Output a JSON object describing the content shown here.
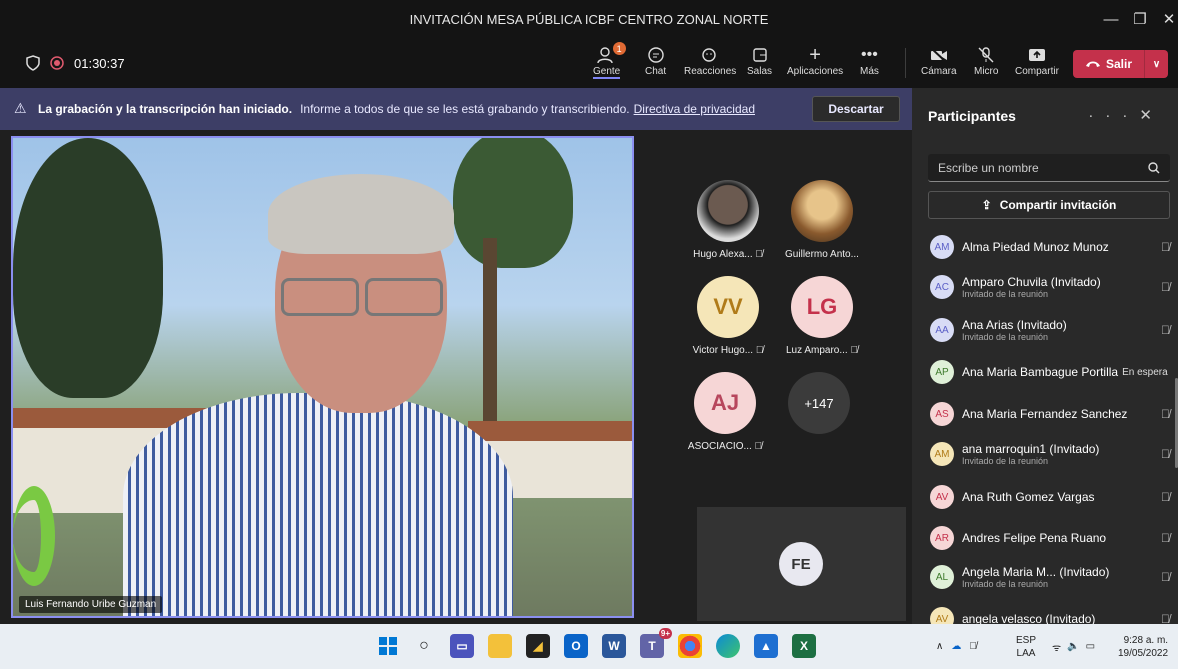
{
  "window": {
    "title": "INVITACIÓN MESA PÚBLICA ICBF CENTRO ZONAL NORTE",
    "controls": [
      "—",
      "❐",
      "✕"
    ]
  },
  "toolbar": {
    "timer": "01:30:37",
    "people_badge": "1",
    "items": [
      {
        "label": "Gente",
        "icon": "people-icon"
      },
      {
        "label": "Chat",
        "icon": "chat-icon"
      },
      {
        "label": "Reacciones",
        "icon": "reactions-icon"
      },
      {
        "label": "Salas",
        "icon": "rooms-icon"
      },
      {
        "label": "Aplicaciones",
        "icon": "plus-icon"
      },
      {
        "label": "Más",
        "icon": "more-icon"
      }
    ],
    "av_controls": [
      {
        "label": "Cámara",
        "icon": "camera-off-icon"
      },
      {
        "label": "Micro",
        "icon": "mic-off-icon"
      },
      {
        "label": "Compartir",
        "icon": "share-icon"
      }
    ],
    "leave_label": "Salir"
  },
  "banner": {
    "bold": "La grabación y la transcripción han iniciado.",
    "text": "Informe a todos de que se les está grabando y transcribiendo.",
    "link": "Directiva de privacidad",
    "dismiss": "Descartar"
  },
  "stage": {
    "main_speaker": "Luis Fernando Uribe Guzman",
    "tiles": [
      {
        "name": "Hugo Alexa...",
        "initials": "",
        "photo": "dark",
        "muted": true
      },
      {
        "name": "Guillermo Anto...",
        "initials": "",
        "photo": "warm",
        "muted": false
      },
      {
        "name": "Victor Hugo...",
        "initials": "VV",
        "color": "#f5e6b8",
        "text_color": "#b07b18",
        "muted": true
      },
      {
        "name": "Luz Amparo...",
        "initials": "LG",
        "color": "#f6d6d6",
        "text_color": "#c4314b",
        "muted": true
      },
      {
        "name": "ASOCIACIO...",
        "initials": "AJ",
        "color": "#f6d6d6",
        "text_color": "#b7475d",
        "muted": true
      }
    ],
    "overflow": "+147",
    "self_initials": "FE"
  },
  "panel": {
    "title": "Participantes",
    "search_placeholder": "Escribe un nombre",
    "share_label": "Compartir invitación",
    "participants": [
      {
        "initials": "AM",
        "name": "Alma Piedad Munoz Munoz",
        "sub": "",
        "status": "",
        "color": "#d8dcf5"
      },
      {
        "initials": "AC",
        "name": "Amparo Chuvila (Invitado)",
        "sub": "Invitado de la reunión",
        "status": "",
        "color": "#d8dcf5"
      },
      {
        "initials": "AA",
        "name": "Ana Arias (Invitado)",
        "sub": "Invitado de la reunión",
        "status": "",
        "color": "#d8dcf5"
      },
      {
        "initials": "AP",
        "name": "Ana Maria Bambague Portilla",
        "sub": "",
        "status": "En espera",
        "color": "#dff0d8"
      },
      {
        "initials": "AS",
        "name": "Ana Maria Fernandez Sanchez",
        "sub": "",
        "status": "",
        "color": "#f6d6d6"
      },
      {
        "initials": "AM",
        "name": "ana marroquin1 (Invitado)",
        "sub": "Invitado de la reunión",
        "status": "",
        "color": "#f5e6b8"
      },
      {
        "initials": "AV",
        "name": "Ana Ruth Gomez Vargas",
        "sub": "",
        "status": "",
        "color": "#f6d6d6"
      },
      {
        "initials": "AR",
        "name": "Andres Felipe Pena Ruano",
        "sub": "",
        "status": "",
        "color": "#f6d6d6"
      },
      {
        "initials": "AL",
        "name": "Angela Maria M...  (Invitado)",
        "sub": "Invitado de la reunión",
        "status": "",
        "color": "#dff0d8"
      },
      {
        "initials": "AV",
        "name": "angela velasco (Invitado)",
        "sub": "",
        "status": "",
        "color": "#f5e6b8"
      }
    ]
  },
  "taskbar": {
    "lang": "ESP",
    "lang2": "LAA",
    "time": "9:28 a. m.",
    "date": "19/05/2022",
    "teams_badge": "9+"
  }
}
